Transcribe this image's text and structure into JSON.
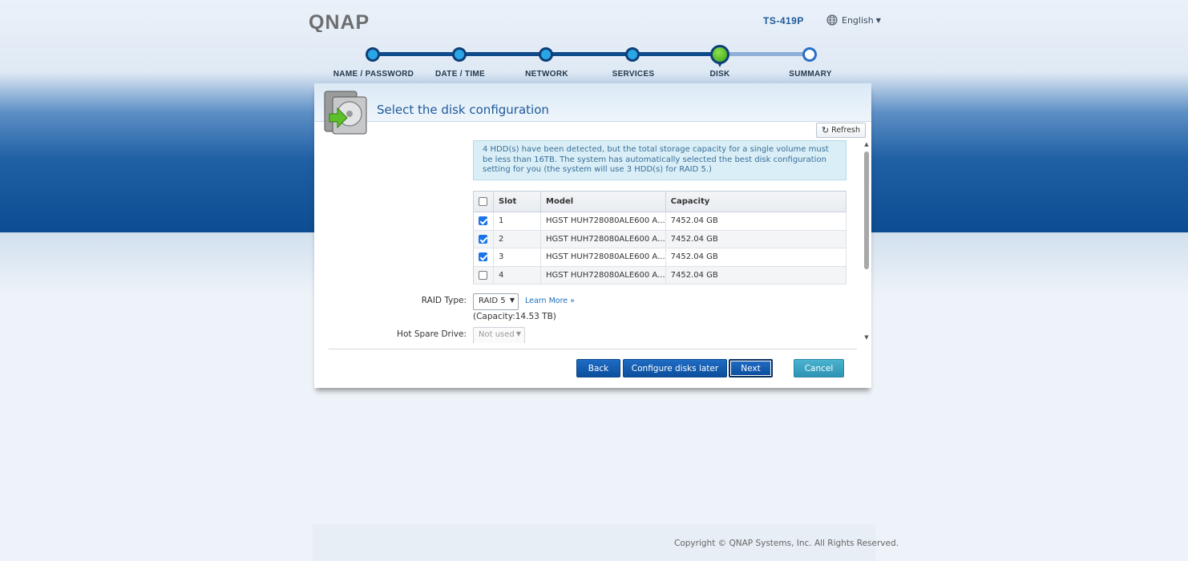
{
  "header": {
    "brand": "QNAP",
    "model": "TS-419P",
    "language": "English"
  },
  "steps": [
    {
      "label": "NAME / PASSWORD",
      "state": "done"
    },
    {
      "label": "DATE / TIME",
      "state": "done"
    },
    {
      "label": "NETWORK",
      "state": "done"
    },
    {
      "label": "SERVICES",
      "state": "done"
    },
    {
      "label": "DISK",
      "state": "current"
    },
    {
      "label": "SUMMARY",
      "state": "todo"
    }
  ],
  "panel": {
    "title": "Select the disk configuration",
    "refresh_label": "Refresh",
    "info_message": "4 HDD(s) have been detected, but the total storage capacity for a single volume must be less than 16TB. The system has automatically selected the best disk configuration setting for you (the system will use 3 HDD(s) for RAID 5.)",
    "table": {
      "columns": [
        "Slot",
        "Model",
        "Capacity"
      ],
      "select_all_checked": false,
      "rows": [
        {
          "checked": true,
          "slot": "1",
          "model": "HGST HUH728080ALE600 A...",
          "capacity": "7452.04 GB"
        },
        {
          "checked": true,
          "slot": "2",
          "model": "HGST HUH728080ALE600 A...",
          "capacity": "7452.04 GB"
        },
        {
          "checked": true,
          "slot": "3",
          "model": "HGST HUH728080ALE600 A...",
          "capacity": "7452.04 GB"
        },
        {
          "checked": false,
          "slot": "4",
          "model": "HGST HUH728080ALE600 A...",
          "capacity": "7452.04 GB"
        }
      ]
    },
    "raid_type_label": "RAID Type:",
    "raid_type_value": "RAID 5",
    "learn_more_label": "Learn More »",
    "capacity_note": "(Capacity:14.53 TB)",
    "hot_spare_label": "Hot Spare Drive:",
    "hot_spare_value": "Not used"
  },
  "buttons": {
    "back": "Back",
    "configure_later": "Configure disks later",
    "next": "Next",
    "cancel": "Cancel"
  },
  "footer": {
    "copyright": "Copyright © QNAP Systems, Inc. All Rights Reserved."
  },
  "colors": {
    "accent": "#1d5a9a",
    "primary_button": "#0c4e9c",
    "cancel_button": "#2d94b3",
    "current_step": "#3aa31a"
  }
}
